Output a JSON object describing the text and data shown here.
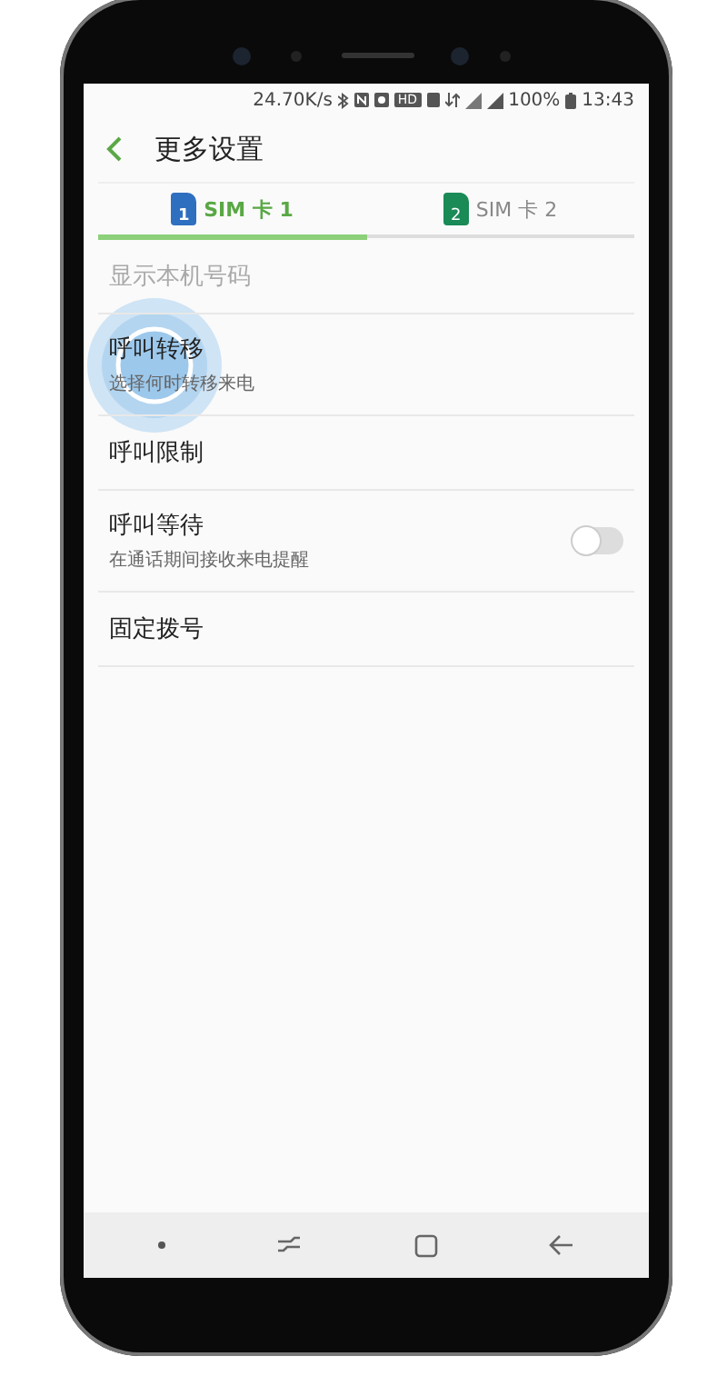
{
  "status_bar": {
    "speed": "24.70K/s",
    "hd_badge": "HD",
    "battery": "100%",
    "time": "13:43"
  },
  "header": {
    "title": "更多设置"
  },
  "tabs": [
    {
      "label": "SIM 卡 1",
      "badge": "1",
      "color": "#2f6fc0",
      "selected": true
    },
    {
      "label": "SIM 卡 2",
      "badge": "2",
      "color": "#1a8a57",
      "selected": false
    }
  ],
  "settings": [
    {
      "kind": "item",
      "title": "显示本机号码",
      "disabled": true
    },
    {
      "kind": "item",
      "title": "呼叫转移",
      "subtitle": "选择何时转移来电",
      "disabled": false
    },
    {
      "kind": "item",
      "title": "呼叫限制",
      "disabled": false
    },
    {
      "kind": "toggle",
      "title": "呼叫等待",
      "subtitle": "在通话期间接收来电提醒",
      "on": false,
      "disabled": false
    },
    {
      "kind": "item",
      "title": "固定拨号",
      "disabled": false
    }
  ]
}
